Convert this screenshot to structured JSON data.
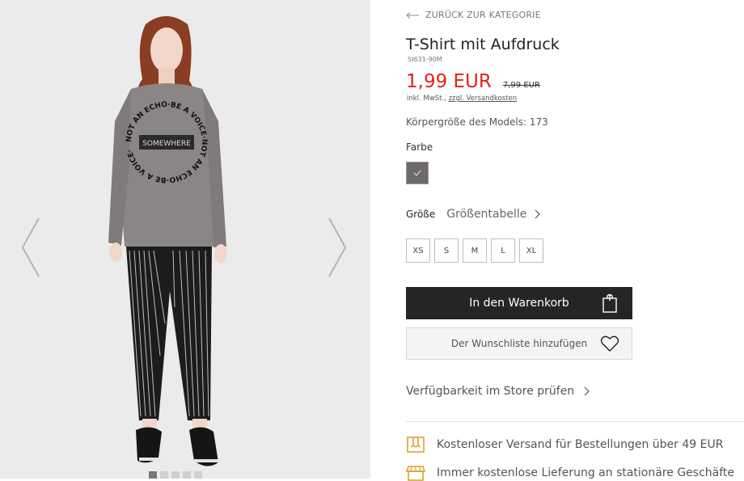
{
  "gallery": {
    "prev_icon": "chevron-left-icon",
    "next_icon": "chevron-right-icon",
    "shirt_print": {
      "ring_text": "NOT AN ECHO·BE A VOICE·NOT AN ECHO·BE A VOICE·",
      "center_text": "SOMEWHERE"
    },
    "image_count": 5,
    "active_index": 0
  },
  "back": {
    "label": "ZURÜCK ZUR KATEGORIE",
    "icon": "arrow-left-icon"
  },
  "product": {
    "title": "T-Shirt mit Aufdruck",
    "sku": "SI631-90M",
    "price": "1,99 EUR",
    "old_price": "7,99 EUR",
    "tax_prefix": "inkl. MwSt., ",
    "shipping_link": "zzgl. Versandkosten",
    "model_height": "Körpergröße des Models: 173"
  },
  "color": {
    "label": "Farbe",
    "swatch_hex": "#6e6a6a",
    "check_icon": "checkmark-icon"
  },
  "size": {
    "label": "Größe",
    "chart_link": "Größentabelle",
    "chart_icon": "chevron-right-icon",
    "options": [
      "XS",
      "S",
      "M",
      "L",
      "XL"
    ]
  },
  "actions": {
    "cart_label": "In den Warenkorb",
    "cart_icon": "shopping-bag-icon",
    "wishlist_label": "Der Wunschliste hinzufügen",
    "wishlist_icon": "heart-icon",
    "store_check": "Verfügbarkeit im Store prüfen",
    "store_icon": "chevron-right-icon"
  },
  "info": [
    {
      "icon": "gift-box-icon",
      "text": "Kostenloser Versand für Bestellungen über 49 EUR"
    },
    {
      "icon": "store-icon",
      "text": "Immer kostenlose Lieferung an stationäre Geschäfte"
    }
  ],
  "colors": {
    "accent_price": "#e2231a",
    "icon_gold": "#d9a32b",
    "button_dark": "#252525"
  }
}
